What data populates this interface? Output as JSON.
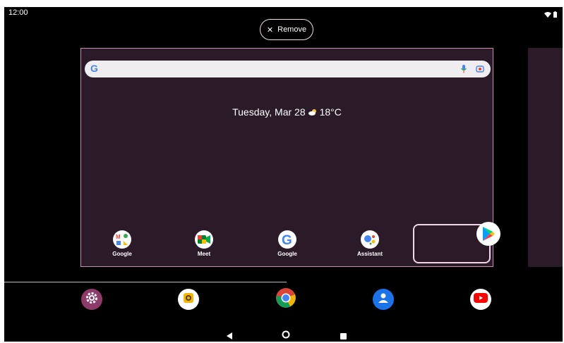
{
  "status": {
    "time": "12:00",
    "icons": [
      "wifi-icon",
      "battery-icon"
    ]
  },
  "remove_button": {
    "icon": "close-icon",
    "label": "Remove"
  },
  "search_bar": {
    "icons": [
      "google-g-icon",
      "mic-icon",
      "lens-icon"
    ]
  },
  "date_weather": {
    "date": "Tuesday, Mar 28",
    "weather_icon": "cloud-sun-icon",
    "temperature": "18°C"
  },
  "home_apps": [
    {
      "label": "Google",
      "icon": "google-folder-icon"
    },
    {
      "label": "Meet",
      "icon": "meet-icon"
    },
    {
      "label": "Google",
      "icon": "google-icon"
    },
    {
      "label": "Assistant",
      "icon": "assistant-icon"
    }
  ],
  "dragged_app": {
    "icon": "play-store-icon"
  },
  "dock": [
    {
      "icon": "settings-icon"
    },
    {
      "icon": "camera-icon"
    },
    {
      "icon": "chrome-icon"
    },
    {
      "icon": "contacts-icon"
    },
    {
      "icon": "youtube-icon"
    }
  ],
  "nav": [
    "back-icon",
    "home-icon",
    "recents-icon"
  ],
  "colors": {
    "page_bg": "#2b1a28",
    "accent_border": "#c58eb3",
    "search_bg": "#efedf0"
  }
}
